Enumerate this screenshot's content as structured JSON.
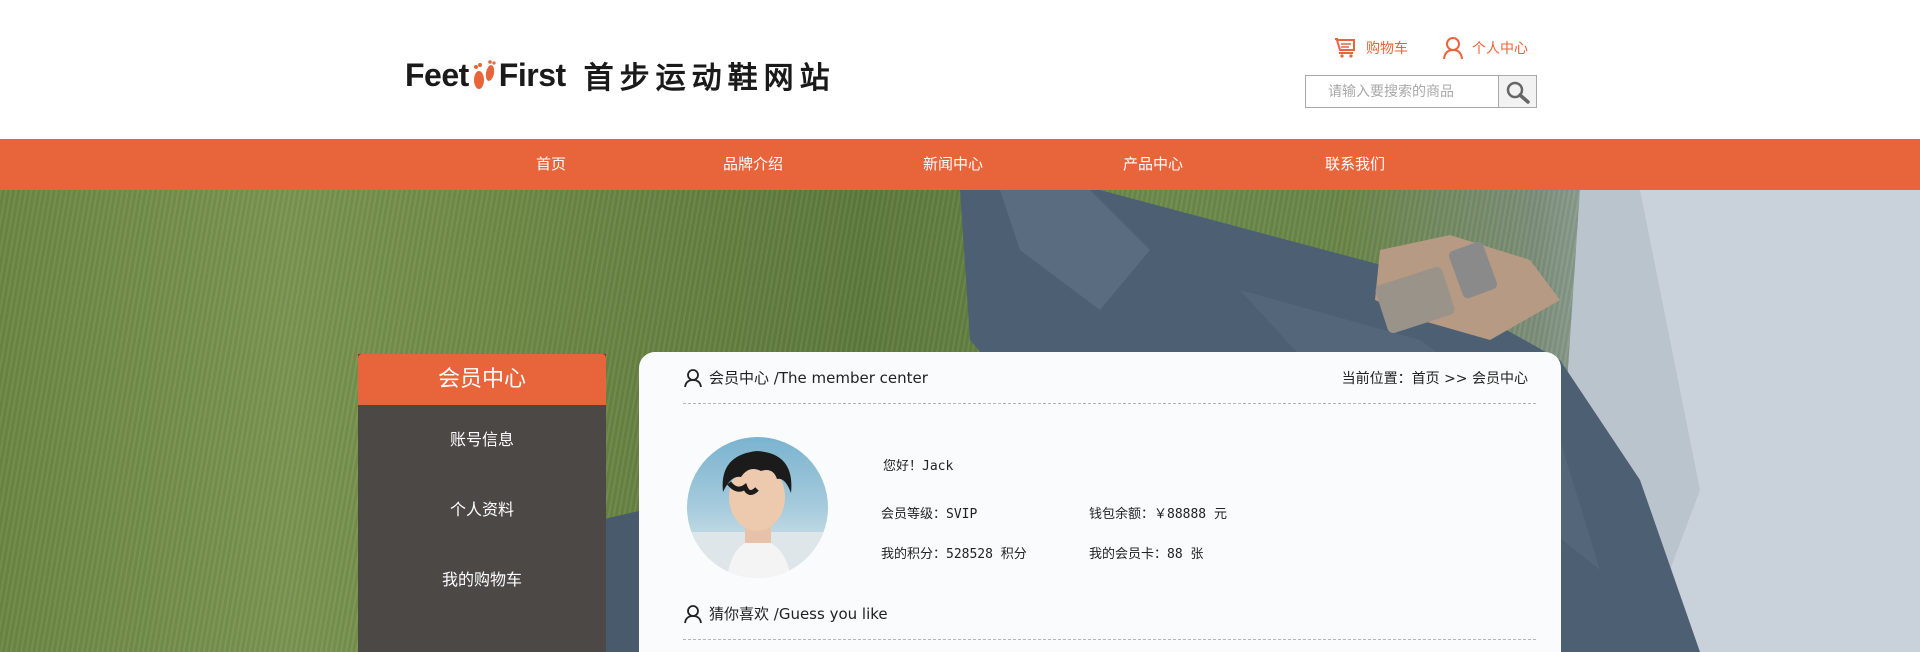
{
  "header": {
    "logo_text_1": "Feet",
    "logo_text_2": "First",
    "logo_cn": "首步运动鞋网站",
    "cart_label": "购物车",
    "member_label": "个人中心",
    "search_placeholder": "请输入要搜索的商品"
  },
  "nav": {
    "items": [
      "首页",
      "品牌介绍",
      "新闻中心",
      "产品中心",
      "联系我们"
    ]
  },
  "sidebar": {
    "title": "会员中心",
    "items": [
      "账号信息",
      "个人资料",
      "我的购物车"
    ]
  },
  "member": {
    "section_title": "会员中心 /The member center",
    "breadcrumb": "当前位置：首页 >> 会员中心",
    "greeting": "您好！Jack",
    "level": "会员等级：SVIP",
    "balance": "钱包余额：￥88888 元",
    "points": "我的积分：528528 积分",
    "cards": "我的会员卡：88 张"
  },
  "guess": {
    "section_title": "猜你喜欢 /Guess you like"
  },
  "colors": {
    "accent": "#e8643a",
    "sidebar_bg": "#4b4846"
  }
}
